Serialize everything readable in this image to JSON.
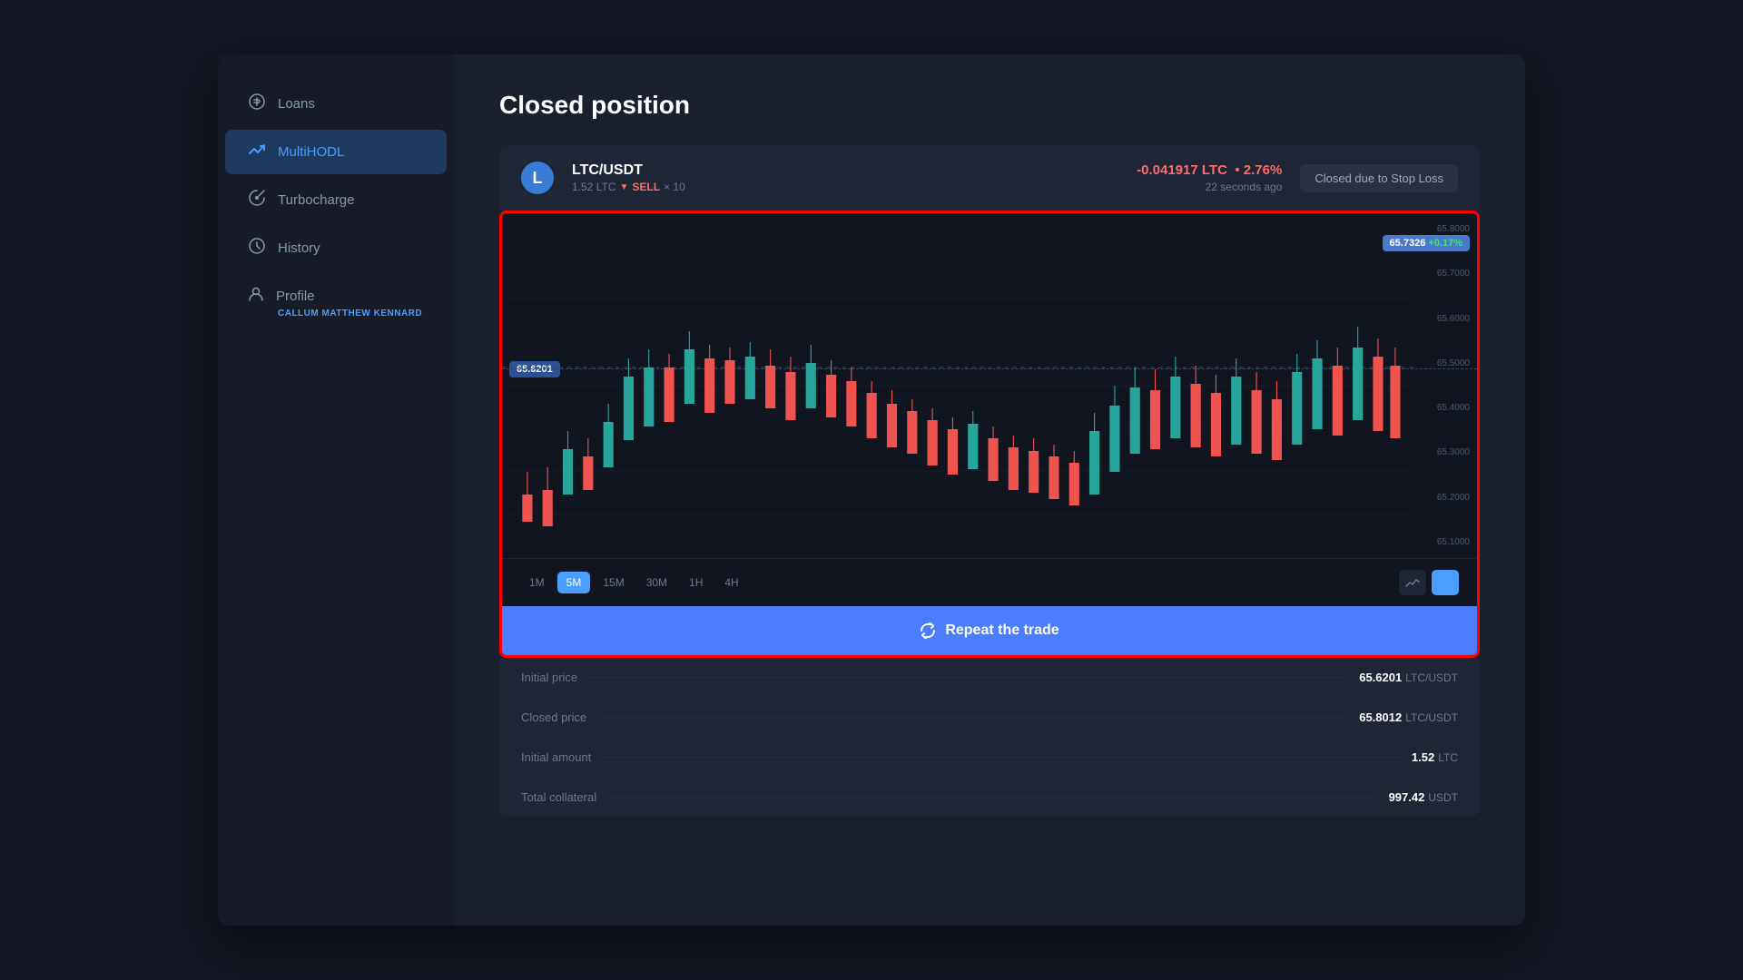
{
  "sidebar": {
    "items": [
      {
        "id": "loans",
        "label": "Loans",
        "icon": "💰",
        "active": false
      },
      {
        "id": "multihodl",
        "label": "MultiHODL",
        "icon": "📈",
        "active": true
      },
      {
        "id": "turbocharge",
        "label": "Turbocharge",
        "icon": "⚡",
        "active": false
      },
      {
        "id": "history",
        "label": "History",
        "icon": "🕐",
        "active": false
      }
    ],
    "profile": {
      "label": "Profile",
      "icon": "👤",
      "name": "CALLUM MATTHEW KENNARD"
    }
  },
  "page": {
    "title": "Closed position"
  },
  "position": {
    "coin": "L",
    "coin_color": "#3a7bd5",
    "pair": "LTC/USDT",
    "amount": "1.52 LTC",
    "direction": "SELL",
    "multiplier": "× 10",
    "pnl": "-0.041917 LTC",
    "pnl_pct": "2.76%",
    "time_ago": "22 seconds ago",
    "status": "Closed due to Stop Loss",
    "arrow_down": "▼"
  },
  "chart": {
    "current_price": "65.7326",
    "current_change": "+0.17%",
    "initial_price_label": "65.6201",
    "y_labels": [
      "65.6000",
      "65.5000",
      "65.4000",
      "65.3000",
      "65.2000",
      "65.1000"
    ],
    "y_labels_top": [
      "65.8000",
      "65.7000"
    ],
    "timeframes": [
      {
        "label": "1M",
        "active": false
      },
      {
        "label": "5M",
        "active": true
      },
      {
        "label": "15M",
        "active": false
      },
      {
        "label": "30M",
        "active": false
      },
      {
        "label": "1H",
        "active": false
      },
      {
        "label": "4H",
        "active": false
      }
    ],
    "chart_types": [
      {
        "label": "〜",
        "active": false,
        "id": "line"
      },
      {
        "label": "▮▮",
        "active": true,
        "id": "candle"
      }
    ]
  },
  "repeat_button": {
    "label": "Repeat the trade",
    "icon": "↗"
  },
  "stats": [
    {
      "label": "Initial price",
      "value": "65.6201",
      "unit": "LTC/USDT"
    },
    {
      "label": "Closed price",
      "value": "65.8012",
      "unit": "LTC/USDT"
    },
    {
      "label": "Initial amount",
      "value": "1.52",
      "unit": "LTC"
    },
    {
      "label": "Total collateral",
      "value": "997.42",
      "unit": "USDT"
    }
  ]
}
